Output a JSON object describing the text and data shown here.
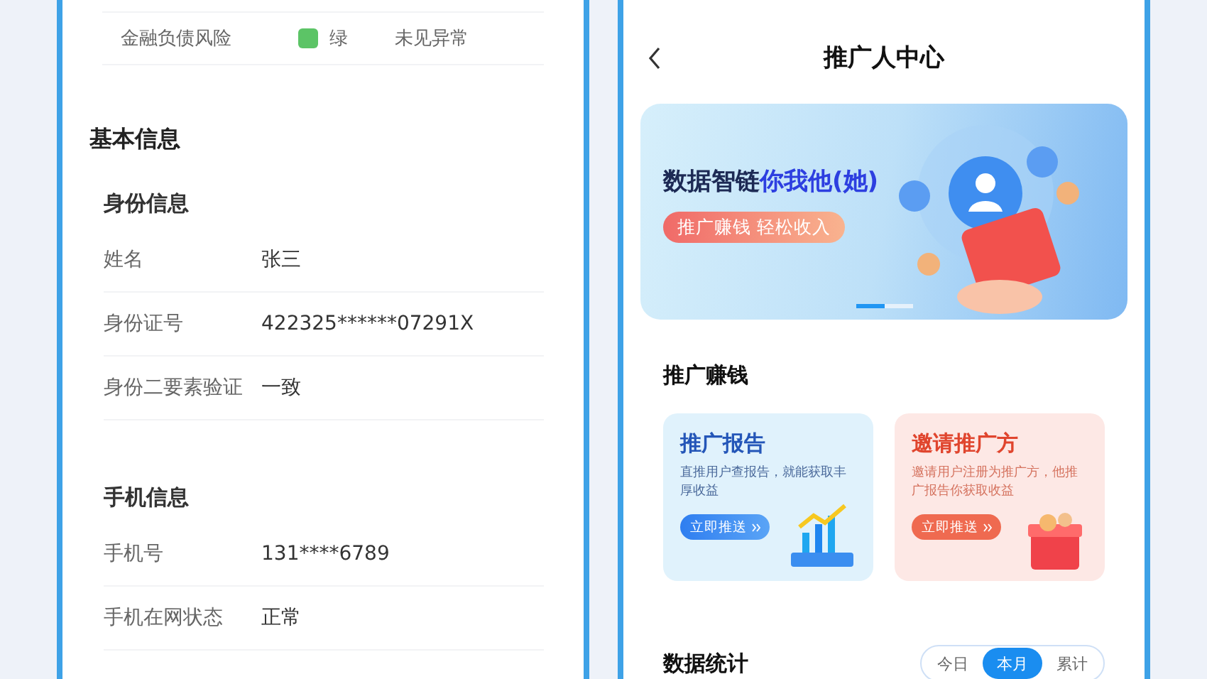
{
  "left_panel": {
    "risk_row": {
      "label": "金融负债风险",
      "color": "#5cc466",
      "level_text": "绿",
      "result": "未见异常"
    },
    "section_title": "基本信息",
    "groups": [
      {
        "title": "身份信息",
        "rows": [
          {
            "label": "姓名",
            "value": "张三"
          },
          {
            "label": "身份证号",
            "value": "422325******07291X"
          },
          {
            "label": "身份二要素验证",
            "value": "一致"
          }
        ]
      },
      {
        "title": "手机信息",
        "rows": [
          {
            "label": "手机号",
            "value": "131****6789"
          },
          {
            "label": "手机在网状态",
            "value": "正常"
          }
        ]
      }
    ]
  },
  "right_panel": {
    "header": {
      "title": "推广人中心"
    },
    "banner": {
      "title_parts": [
        "数据智链",
        "你我他(她)"
      ],
      "pill": "推广赚钱 轻松收入",
      "pages": [
        {
          "selected": true
        },
        {
          "selected": false
        }
      ]
    },
    "earn_section": {
      "title": "推广赚钱",
      "cards": [
        {
          "kind": "report",
          "title": "推广报告",
          "description": "直推用户查报告，就能获取丰厚收益",
          "button": "立即推送"
        },
        {
          "kind": "invite",
          "title": "邀请推广方",
          "description": "邀请用户注册为推广方，他推广报告你获取收益",
          "button": "立即推送"
        }
      ]
    },
    "stats": {
      "title": "数据统计",
      "tabs": [
        {
          "label": "今日",
          "selected": false
        },
        {
          "label": "本月",
          "selected": true
        },
        {
          "label": "累计",
          "selected": false
        }
      ]
    }
  }
}
